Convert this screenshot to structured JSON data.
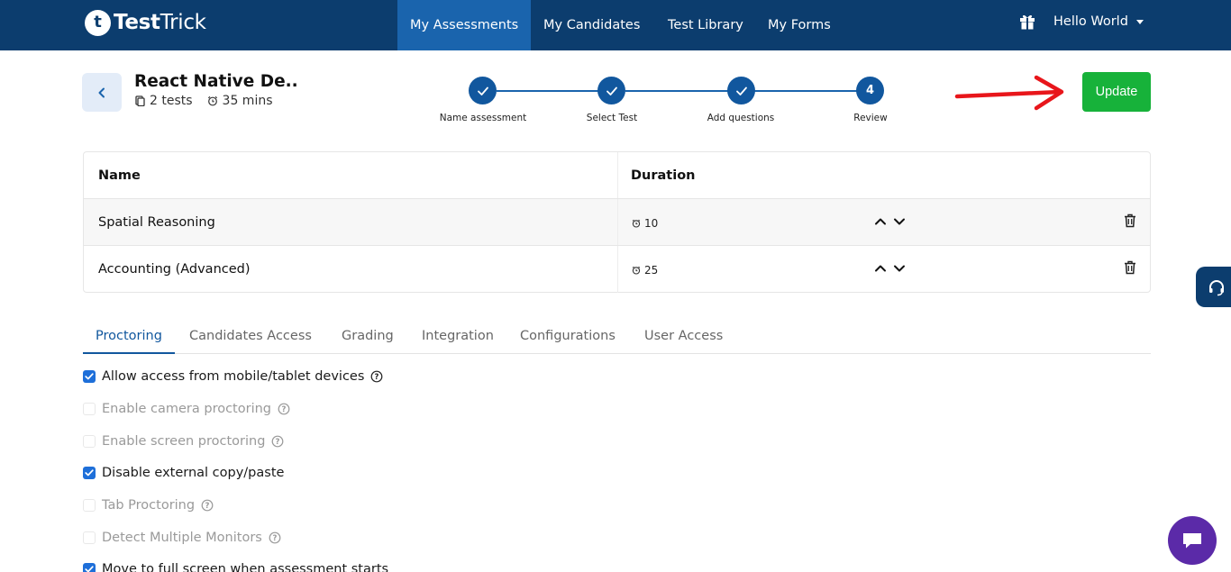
{
  "navbar": {
    "logo_letter": "t",
    "logo_bold": "Test",
    "logo_light": "Trick",
    "items": [
      {
        "label": "My Assessments",
        "active": true
      },
      {
        "label": "My Candidates",
        "active": false
      },
      {
        "label": "Test Library",
        "active": false
      },
      {
        "label": "My Forms",
        "active": false
      }
    ],
    "user_name": "Hello World",
    "icons": [
      "gift-icon",
      "chevron-down-icon"
    ],
    "colors": {
      "background": "#0c3d6e",
      "active_item": "#1a64ad"
    }
  },
  "assessment": {
    "title": "React Native De..",
    "tests_count": "2 tests",
    "duration": "35 mins"
  },
  "stepper": {
    "steps": [
      {
        "label": "Name assessment",
        "state": "done",
        "marker": "check-icon"
      },
      {
        "label": "Select Test",
        "state": "done",
        "marker": "check-icon"
      },
      {
        "label": "Add questions",
        "state": "done",
        "marker": "check-icon"
      },
      {
        "label": "Review",
        "state": "current",
        "marker": "4"
      }
    ]
  },
  "actions": {
    "update_label": "Update",
    "update_color": "#17b23a",
    "annotation_arrow_color": "#e8161b"
  },
  "tests_table": {
    "columns": [
      "Name",
      "Duration"
    ],
    "rows": [
      {
        "name": "Spatial Reasoning",
        "duration": "10"
      },
      {
        "name": "Accounting (Advanced)",
        "duration": "25"
      }
    ]
  },
  "settings_tabs": {
    "items": [
      "Proctoring",
      "Candidates Access",
      "Grading",
      "Integration",
      "Configurations",
      "User Access"
    ],
    "active": "Proctoring"
  },
  "proctoring_options": [
    {
      "label": "Allow access from mobile/tablet devices",
      "checked": true,
      "enabled": true,
      "help": true
    },
    {
      "label": "Enable camera proctoring",
      "checked": false,
      "enabled": false,
      "help": true
    },
    {
      "label": "Enable screen proctoring",
      "checked": false,
      "enabled": false,
      "help": true
    },
    {
      "label": "Disable external copy/paste",
      "checked": true,
      "enabled": true,
      "help": false
    },
    {
      "label": "Tab Proctoring",
      "checked": false,
      "enabled": false,
      "help": true
    },
    {
      "label": "Detect Multiple Monitors",
      "checked": false,
      "enabled": false,
      "help": true
    },
    {
      "label": "Move to full screen when assessment starts",
      "checked": true,
      "enabled": true,
      "help": false
    }
  ]
}
